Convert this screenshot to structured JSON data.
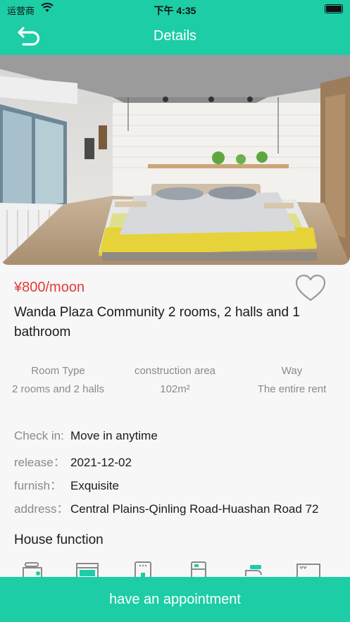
{
  "status_bar": {
    "carrier": "运营商",
    "time": "下午 4:35"
  },
  "nav": {
    "title": "Details",
    "back_icon": "back-arrow-icon"
  },
  "listing": {
    "price": "¥800/moon",
    "title": "Wanda Plaza Community 2 rooms, 2 halls and 1 bathroom",
    "favorite_icon": "heart-outline-icon",
    "stats": [
      {
        "label": "Room Type",
        "value": "2 rooms and 2 halls"
      },
      {
        "label": "construction area",
        "value": "102m²"
      },
      {
        "label": "Way",
        "value": "The entire rent"
      }
    ],
    "details": [
      {
        "key": "Check in:",
        "value": "Move in anytime"
      },
      {
        "key": "release：",
        "value": "2021-12-02"
      },
      {
        "key": "furnish：",
        "value": "Exquisite"
      },
      {
        "key": "address：",
        "value": "Central Plains-Qinling Road-Huashan Road 72"
      }
    ]
  },
  "house_function": {
    "title": "House function",
    "icons": [
      "rice-cooker-icon",
      "microwave-icon",
      "water-heater-icon",
      "refrigerator-icon",
      "faucet-icon",
      "tv-icon"
    ]
  },
  "actions": {
    "appointment_label": "have an appointment"
  },
  "colors": {
    "accent": "#1dcda5",
    "price": "#e33a3a"
  }
}
